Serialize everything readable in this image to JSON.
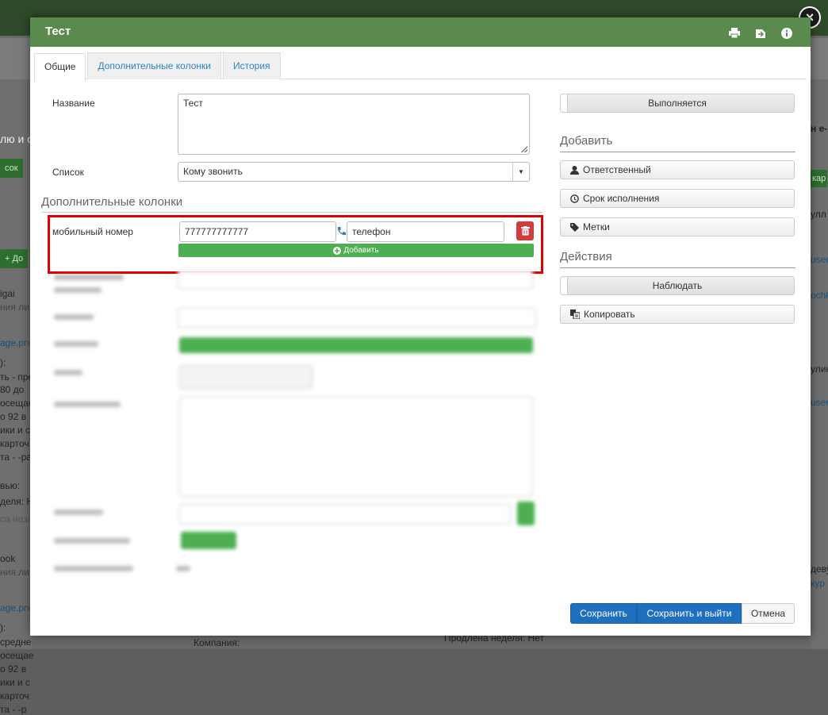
{
  "background": {
    "left_texts": [
      "лю и с",
      "сок",
      "+ До",
      "igai",
      "ния ли",
      "age.png",
      "):",
      "ть - пре",
      " 80 до",
      "осещае",
      "о 92 в",
      "ики и с",
      "карточ",
      "та - -ра",
      "вью:",
      "деля: Н",
      "са назад",
      "ook",
      "ния ли",
      "age.png",
      "):",
      "средне",
      "осещае",
      "о 92 в",
      "ики и с",
      "карточ",
      "та - -р"
    ],
    "right_texts": [
      "н е-",
      "кар",
      "улл",
      "user",
      "ochk",
      "улик",
      "user",
      "деву",
      "кур"
    ],
    "bottom_texts": [
      "Компания:",
      "Продлена неделя: Нет"
    ]
  },
  "modal": {
    "title": "Тест",
    "close_label": "×",
    "tabs": [
      {
        "label": "Общие",
        "active": true
      },
      {
        "label": "Дополнительные колонки",
        "active": false
      },
      {
        "label": "История",
        "active": false
      }
    ],
    "form": {
      "name_label": "Название",
      "name_value": "Тест",
      "list_label": "Список",
      "list_value": "Кому звонить",
      "extra_columns_title": "Дополнительные колонки",
      "mobile_label": "мобильный номер",
      "mobile_value": "777777777777",
      "phone_type_value": "телефон",
      "add_label": "Добавить"
    },
    "sidebar": {
      "status_label": "Выполняется",
      "add_title": "Добавить",
      "responsible_label": "Ответственный",
      "deadline_label": "Срок исполнения",
      "tags_label": "Метки",
      "actions_title": "Действия",
      "watch_label": "Наблюдать",
      "copy_label": "Копировать"
    },
    "footer": {
      "save_label": "Сохранить",
      "save_exit_label": "Сохранить и выйти",
      "cancel_label": "Отмена"
    }
  },
  "colors": {
    "header": "#5b8a4f",
    "primary": "#1f6fbf",
    "success": "#4caf50",
    "danger": "#d23c3c",
    "highlight": "#e10000"
  }
}
